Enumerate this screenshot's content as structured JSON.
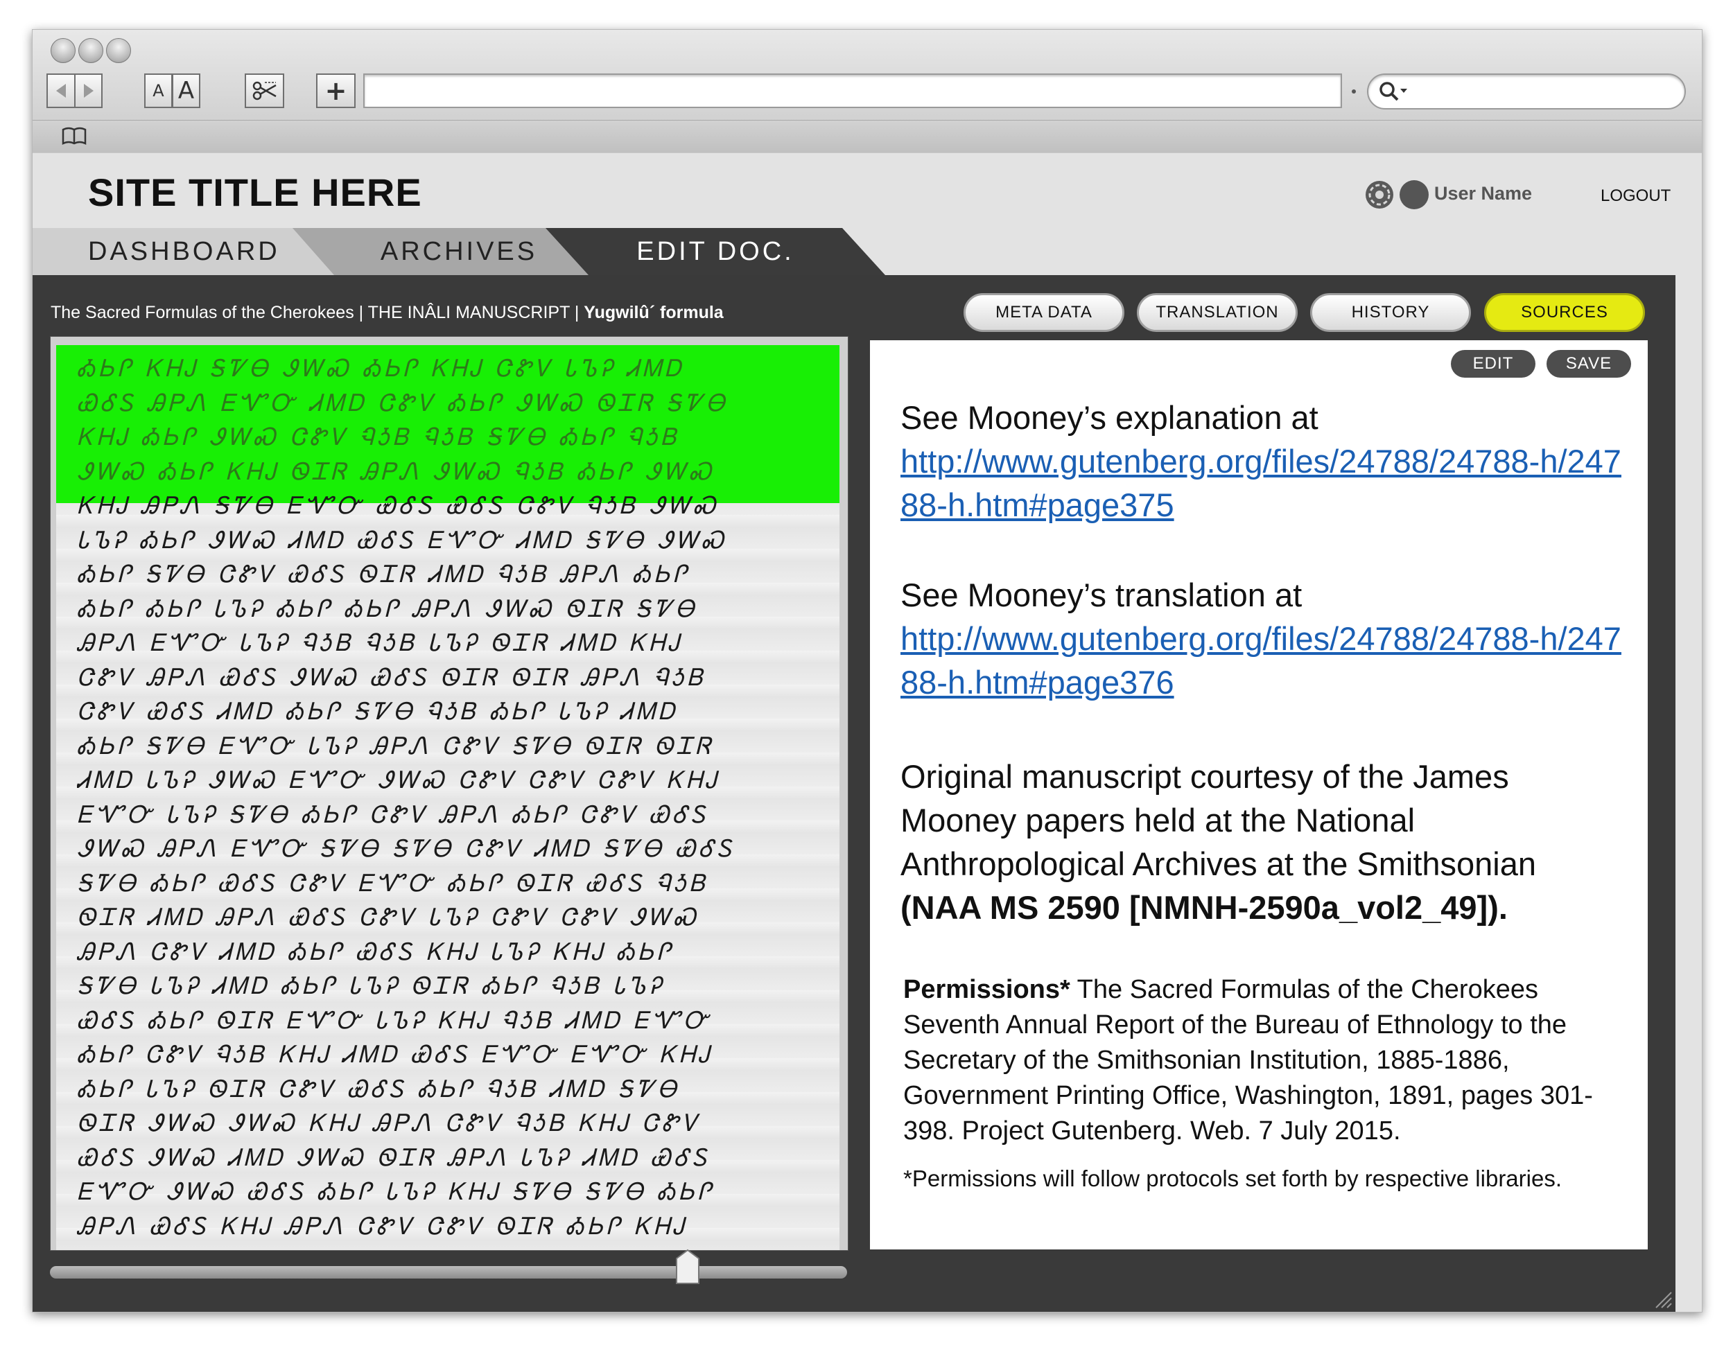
{
  "browser": {
    "font_small_label": "A",
    "font_large_label": "A",
    "add_label": "+",
    "url": "",
    "search": ""
  },
  "site": {
    "title": "SITE TITLE HERE",
    "user_name": "User Name",
    "logout": "LOGOUT"
  },
  "tabs": [
    {
      "label": "DASHBOARD"
    },
    {
      "label": "ARCHIVES"
    },
    {
      "label": "EDIT DOC."
    }
  ],
  "breadcrumb": {
    "part1": "The Sacred Formulas of the Cherokees",
    "sep": " | ",
    "part2": "THE INÂLI MANUSCRIPT",
    "part3": "Yugwilû´ formula"
  },
  "panel_tabs": [
    {
      "label": "META DATA",
      "active": false
    },
    {
      "label": "TRANSLATION",
      "active": false
    },
    {
      "label": "HISTORY",
      "active": false
    },
    {
      "label": "SOURCES",
      "active": true
    }
  ],
  "panel_actions": {
    "edit": "EDIT",
    "save": "SAVE"
  },
  "sources": {
    "explanation_intro": "See Mooney’s explanation at",
    "explanation_url": "http://www.gutenberg.org/files/24788/24788-h/24788-h.htm#page375",
    "translation_intro": "See Mooney’s translation at",
    "translation_url": "http://www.gutenberg.org/files/24788/24788-h/24788-h.htm#page376",
    "courtesy": "Original manuscript courtesy of the James Mooney papers held at the National Anthropological Archives at the Smithsonian",
    "courtesy_ref": "(NAA MS 2590 [NMNH-2590a_vol2_49]).",
    "permissions_label": "Permissions*",
    "permissions_text": " The Sacred Formulas of the Cherokees Seventh Annual Report of the Bureau of Ethnology to the Secretary of the Smithsonian Institution, 1885-1886, Government Printing Office, Washington, 1891, pages 301-398. Project Gutenberg. Web. 7 July 2015.",
    "permissions_note": "*Permissions will follow protocols set forth by respective libraries."
  },
  "document_image": {
    "highlighted_lines": 4,
    "zoom_slider_fraction": 0.8
  },
  "colors": {
    "highlight": "#18ef05",
    "active_tab": "#e5ea12",
    "link": "#1a5fb4",
    "workspace": "#3a3a3a"
  }
}
